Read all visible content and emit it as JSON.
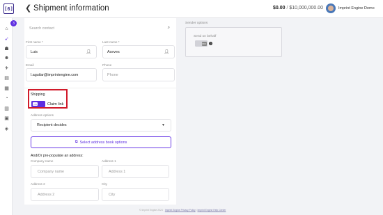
{
  "header": {
    "logo_text": "[6]",
    "back_icon": "chevron-left-icon",
    "title": "Shipment information",
    "balance": "$0.00",
    "balance_sep": " / ",
    "balance_limit": "$10,000,000.00",
    "user_name": "Imprint Engine Demo"
  },
  "sidebar": {
    "badge": "3",
    "items": [
      {
        "icon": "home-icon",
        "glyph": "⌂"
      },
      {
        "icon": "send-icon",
        "glyph": "➶",
        "active": true
      },
      {
        "icon": "users-icon",
        "glyph": "☗"
      },
      {
        "icon": "people-icon",
        "glyph": "☻"
      },
      {
        "icon": "campaign-icon",
        "glyph": "✈"
      },
      {
        "icon": "document-icon",
        "glyph": "▤"
      },
      {
        "icon": "grid-icon",
        "glyph": "▦"
      },
      {
        "icon": "analytics-icon",
        "glyph": "◔"
      },
      {
        "icon": "store-icon",
        "glyph": "▥"
      },
      {
        "icon": "inbox-icon",
        "glyph": "▣"
      },
      {
        "icon": "integrations-icon",
        "glyph": "◈"
      }
    ]
  },
  "form": {
    "search_placeholder": "Search contact",
    "first_name_label": "First name *",
    "first_name_value": "Luis",
    "last_name_label": "Last name *",
    "last_name_value": "Aceves",
    "email_label": "Email",
    "email_value": "l.aguilar@imprintengine.com",
    "phone_label": "Phone",
    "phone_placeholder": "Phone"
  },
  "shipping": {
    "title": "Shipping",
    "toggle_state": "ON",
    "claim_label": "Claim link",
    "address_options_label": "Address options",
    "address_option_selected": "Recipient decides",
    "address_book_button": "Select address book options",
    "prepopulate_label": "And/Or pre-populate an address:",
    "company_label": "Company name",
    "company_placeholder": "Company name",
    "address1_label": "Address 1",
    "address1_placeholder": "Address 1",
    "address2_label": "Address 2",
    "address2_placeholder": "Address 2",
    "city_label": "City",
    "city_placeholder": "City"
  },
  "sender": {
    "title": "Sender options",
    "send_on_behalf_label": "Send on behalf",
    "toggle_state": "OFF"
  },
  "footer": {
    "copyright": "© Imprint Engine 2024 · ",
    "link1": "Imprint Engine Privacy Policy",
    "separator": " | ",
    "link2": "Imprint Engine Help Center"
  },
  "colors": {
    "accent": "#5d2de0",
    "highlight": "#d11a2a"
  }
}
